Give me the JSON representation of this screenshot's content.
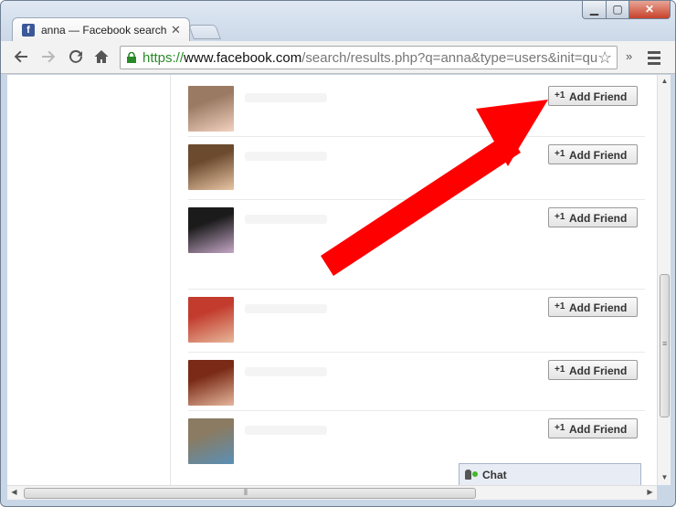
{
  "browser": {
    "tab_title": "anna — Facebook search",
    "tab_favicon": "f",
    "close_glyph": "✕",
    "url_scheme": "https://",
    "url_host": "www.facebook.com",
    "url_path": "/search/results.php?q=anna&type=users&init=qu",
    "overflow_glyph": "»"
  },
  "window_controls": {
    "minimize": "▁",
    "maximize": "▢",
    "close": "✕"
  },
  "results": [
    {
      "button_label": "Add Friend",
      "avatar_colors": [
        "#9a7a62",
        "#f2d2c0"
      ]
    },
    {
      "button_label": "Add Friend",
      "avatar_colors": [
        "#6b4a2e",
        "#e9c5a5"
      ]
    },
    {
      "button_label": "Add Friend",
      "avatar_colors": [
        "#1b1b1b",
        "#c5a7c7"
      ]
    },
    {
      "button_label": "Add Friend",
      "avatar_colors": [
        "#c23b2d",
        "#e7b79a"
      ]
    },
    {
      "button_label": "Add Friend",
      "avatar_colors": [
        "#7a2a16",
        "#e5b69c"
      ]
    },
    {
      "button_label": "Add Friend",
      "avatar_colors": [
        "#8a7b62",
        "#5a8fb5"
      ]
    }
  ],
  "chat": {
    "label": "Chat"
  },
  "icons": {
    "back": "back-arrow-icon",
    "forward": "forward-arrow-icon",
    "reload": "reload-icon",
    "home": "home-icon",
    "lock": "lock-icon",
    "star": "star-icon",
    "menu": "menu-icon",
    "add_friend": "add-friend-icon",
    "chat_status": "online-dot-icon"
  },
  "colors": {
    "facebook_blue": "#3b5998",
    "annotation_arrow": "#ff0000",
    "secure_green": "#2a8a2a"
  }
}
